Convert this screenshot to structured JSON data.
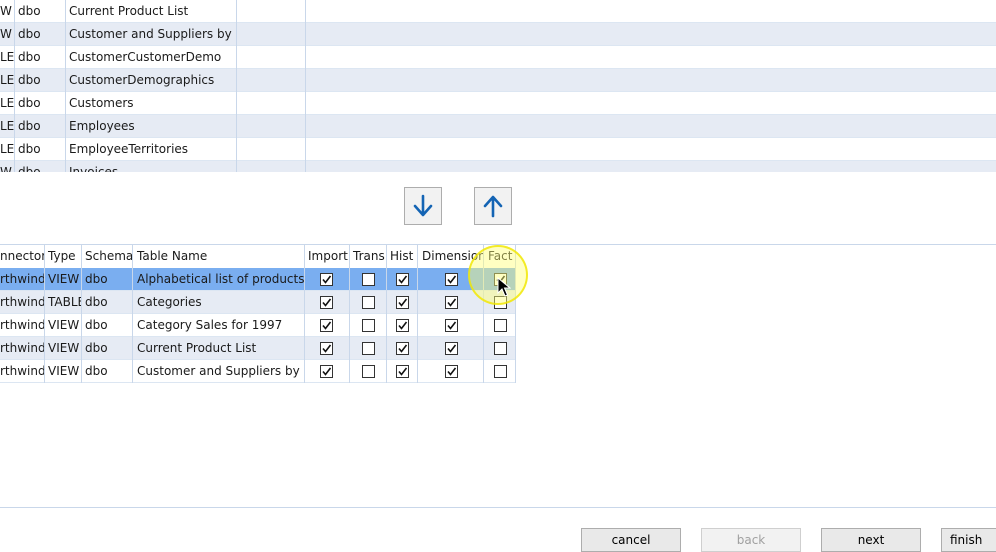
{
  "top_grid": {
    "rows": [
      {
        "type": "W",
        "schema": "dbo",
        "name": "Current Product List"
      },
      {
        "type": "W",
        "schema": "dbo",
        "name": "Customer and Suppliers by City"
      },
      {
        "type": "LE",
        "schema": "dbo",
        "name": "CustomerCustomerDemo"
      },
      {
        "type": "LE",
        "schema": "dbo",
        "name": "CustomerDemographics"
      },
      {
        "type": "LE",
        "schema": "dbo",
        "name": "Customers"
      },
      {
        "type": "LE",
        "schema": "dbo",
        "name": "Employees"
      },
      {
        "type": "LE",
        "schema": "dbo",
        "name": "EmployeeTerritories"
      },
      {
        "type": "W",
        "schema": "dbo",
        "name": "Invoices"
      }
    ]
  },
  "move_buttons": {
    "down_icon": "arrow-down-icon",
    "up_icon": "arrow-up-icon",
    "accent_color": "#1464b4"
  },
  "bottom_grid": {
    "headers": {
      "connector": "nnector",
      "type": "Type",
      "schema": "Schema",
      "table_name": "Table Name",
      "import": "Import",
      "trans": "Trans",
      "hist": "Hist",
      "dimension": "Dimension",
      "fact": "Fact"
    },
    "rows": [
      {
        "connector": "rthwind",
        "type": "VIEW",
        "schema": "dbo",
        "name": "Alphabetical list of products",
        "import": true,
        "trans": false,
        "hist": true,
        "dimension": true,
        "fact": true,
        "selected": true
      },
      {
        "connector": "rthwind",
        "type": "TABLE",
        "schema": "dbo",
        "name": "Categories",
        "import": true,
        "trans": false,
        "hist": true,
        "dimension": true,
        "fact": false,
        "selected": false
      },
      {
        "connector": "rthwind",
        "type": "VIEW",
        "schema": "dbo",
        "name": "Category Sales for 1997",
        "import": true,
        "trans": false,
        "hist": true,
        "dimension": true,
        "fact": false,
        "selected": false
      },
      {
        "connector": "rthwind",
        "type": "VIEW",
        "schema": "dbo",
        "name": "Current Product List",
        "import": true,
        "trans": false,
        "hist": true,
        "dimension": true,
        "fact": false,
        "selected": false
      },
      {
        "connector": "rthwind",
        "type": "VIEW",
        "schema": "dbo",
        "name": "Customer and Suppliers by City",
        "import": true,
        "trans": false,
        "hist": true,
        "dimension": true,
        "fact": false,
        "selected": false
      }
    ],
    "selected_color": "#7aaef0"
  },
  "footer": {
    "cancel": "cancel",
    "back": "back",
    "next": "next",
    "finish": "finish"
  }
}
